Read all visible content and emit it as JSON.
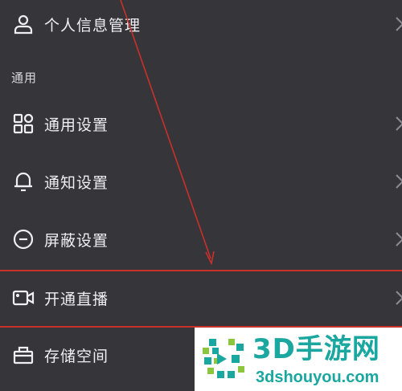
{
  "menu": {
    "personal_info": {
      "label": "个人信息管理",
      "icon": "user-icon"
    },
    "section_general": "通用",
    "general_settings": {
      "label": "通用设置",
      "icon": "grid-icon"
    },
    "notification_settings": {
      "label": "通知设置",
      "icon": "bell-icon"
    },
    "block_settings": {
      "label": "屏蔽设置",
      "icon": "minus-circle-icon"
    },
    "open_live": {
      "label": "开通直播",
      "icon": "video-camera-icon"
    },
    "storage": {
      "label": "存储空间",
      "icon": "briefcase-icon"
    }
  },
  "annotation": {
    "color": "#c9302c",
    "highlighted_item": "开通直播"
  },
  "watermark": {
    "title": "3D手游网",
    "url": "3dshouyou.com",
    "color": "#1aa7a0"
  },
  "colors": {
    "background": "#36353a",
    "text": "#efeef2"
  }
}
